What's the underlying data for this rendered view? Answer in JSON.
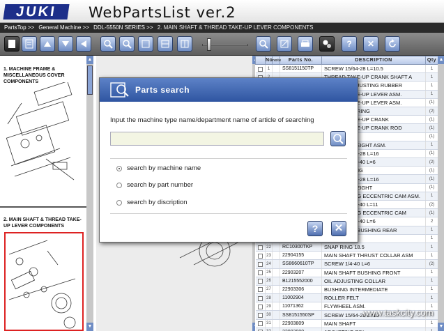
{
  "header": {
    "logo_text": "JUKI",
    "title": "WebPartsList ver.2"
  },
  "breadcrumb": {
    "root": "PartsTop >>",
    "items": [
      "General Machine >>",
      "DDL-5550N SERIES >>",
      "2.  MAIN SHAFT & THREAD TAKE-UP LEVER COMPONENTS"
    ]
  },
  "toolbar": {
    "icons": [
      "page-icon",
      "list-icon",
      "arrow-up-icon",
      "arrow-down-icon",
      "arrow-left-icon",
      "zoom-in-icon",
      "zoom-out-icon",
      "fit-page-icon",
      "fit-width-icon",
      "fit-height-icon",
      "zoom-slider",
      "search-icon",
      "note-icon",
      "print-icon",
      "settings-icon",
      "help-icon",
      "close-icon",
      "refresh-icon"
    ]
  },
  "left_panel": {
    "section1": "1.  MACHINE FRAME & MISCELLANEOUS COVER COMPONENTS",
    "section2": "2.  MAIN SHAFT & THREAD TAKE-UP LEVER COMPONENTS"
  },
  "table": {
    "headers": {
      "no": "No",
      "note": "note",
      "parts_no": "Parts No.",
      "description": "DESCRIPTION",
      "qty": "Qty"
    },
    "rows": [
      {
        "no": "1",
        "parts": "SS8151150TP",
        "desc": "SCREW 15/64-28 L=10.5",
        "qty": "1"
      },
      {
        "no": "2",
        "parts": "",
        "desc": "THREAD TAKE-UP CRANK SHAFT A",
        "qty": "1"
      },
      {
        "no": "3",
        "parts": "",
        "desc": "CUSHION ADJUSTING RUBBER",
        "qty": "1"
      },
      {
        "no": "4",
        "parts": "",
        "desc": "THREAD TAKE-UP LEVER ASM.",
        "qty": "1"
      },
      {
        "no": "5",
        "parts": "",
        "desc": "THREAD TAKE-UP LEVER ASM.",
        "qty": "(1)"
      },
      {
        "no": "6",
        "parts": "",
        "desc": "NEEDLE BEARING",
        "qty": "(2)"
      },
      {
        "no": "7",
        "parts": "",
        "desc": "THREAD TAKE-UP CRANK",
        "qty": "(1)"
      },
      {
        "no": "8",
        "parts": "",
        "desc": "THREAD TAKE-UP CRANK ROD",
        "qty": "(1)"
      },
      {
        "no": "9",
        "parts": "",
        "desc": "HINGE PIN",
        "qty": "(1)"
      },
      {
        "no": "10",
        "parts": "",
        "desc": "COUNTER WEIGHT ASM.",
        "qty": "1"
      },
      {
        "no": "11",
        "parts": "",
        "desc": "SCREW 15/64-28 L=16",
        "qty": "(1)"
      },
      {
        "no": "12",
        "parts": "",
        "desc": "SCREW 11/64-40 L=6",
        "qty": "(2)"
      },
      {
        "no": "13",
        "parts": "",
        "desc": "BALANCE RING",
        "qty": "(1)"
      },
      {
        "no": "14",
        "parts": "",
        "desc": "SCREW 15/64-28 L=16",
        "qty": "(1)"
      },
      {
        "no": "15",
        "parts": "",
        "desc": "COUNTER WEIGHT",
        "qty": "(1)"
      },
      {
        "no": "16",
        "parts": "",
        "desc": "FEED DRIVING ECCENTRIC CAM ASM.",
        "qty": "1"
      },
      {
        "no": "17",
        "parts": "",
        "desc": "SCREW 11/64-40 L=11",
        "qty": "(2)"
      },
      {
        "no": "18",
        "parts": "",
        "desc": "FEED DRIVING ECCENTRIC CAM",
        "qty": "(1)"
      },
      {
        "no": "19",
        "parts": "",
        "desc": "SCREW 11/64-40 L=6",
        "qty": "2"
      },
      {
        "no": "20",
        "parts": "",
        "desc": "MAIN SHAFT BUSHING REAR",
        "qty": "1"
      },
      {
        "no": "21",
        "parts": "",
        "desc": "MAIN SHAFT",
        "qty": "1"
      },
      {
        "no": "22",
        "parts": "RC10300TKP",
        "desc": "SNAP RING 18.5",
        "qty": "1"
      },
      {
        "no": "23",
        "parts": "22904155",
        "desc": "MAIN SHAFT THRUST COLLAR ASM",
        "qty": "1"
      },
      {
        "no": "24",
        "parts": "SS8660610TP",
        "desc": "SCREW  1/4-40 L=6",
        "qty": "(2)"
      },
      {
        "no": "25",
        "parts": "22903207",
        "desc": "MAIN SHAFT BUSHING FRONT",
        "qty": "1"
      },
      {
        "no": "26",
        "parts": "B1215552000",
        "desc": "OIL ADJUSTING COLLAR",
        "qty": "1"
      },
      {
        "no": "27",
        "parts": "22903306",
        "desc": "BUSHING INTERMEDIATE",
        "qty": "1"
      },
      {
        "no": "28",
        "parts": "11002904",
        "desc": "ROLLER FELT",
        "qty": "1"
      },
      {
        "no": "29",
        "parts": "11071362",
        "desc": "FLYWHEEL ASM.",
        "qty": "1"
      },
      {
        "no": "30",
        "parts": "SS8151550SP",
        "desc": "SCREW  15/64-28 L=15",
        "qty": "1"
      },
      {
        "no": "31",
        "parts": "22903809",
        "desc": "MAIN SHAFT",
        "qty": "1"
      },
      {
        "no": "32",
        "parts": "22903900",
        "desc": "ADJUSTING PIN",
        "qty": "1"
      }
    ]
  },
  "modal": {
    "title": "Parts search",
    "prompt": "Input the machine type name/department name of article of searching",
    "input_value": "",
    "options": [
      {
        "label": "search by machine name",
        "selected": true
      },
      {
        "label": "search by part number",
        "selected": false
      },
      {
        "label": "search by discription",
        "selected": false
      }
    ],
    "help_label": "?",
    "close_label": "✕"
  },
  "watermark": "www.taskcity.com",
  "colors": {
    "accent": "#3a62b0",
    "brand": "#1d2f8a",
    "selection": "#dd2222"
  }
}
